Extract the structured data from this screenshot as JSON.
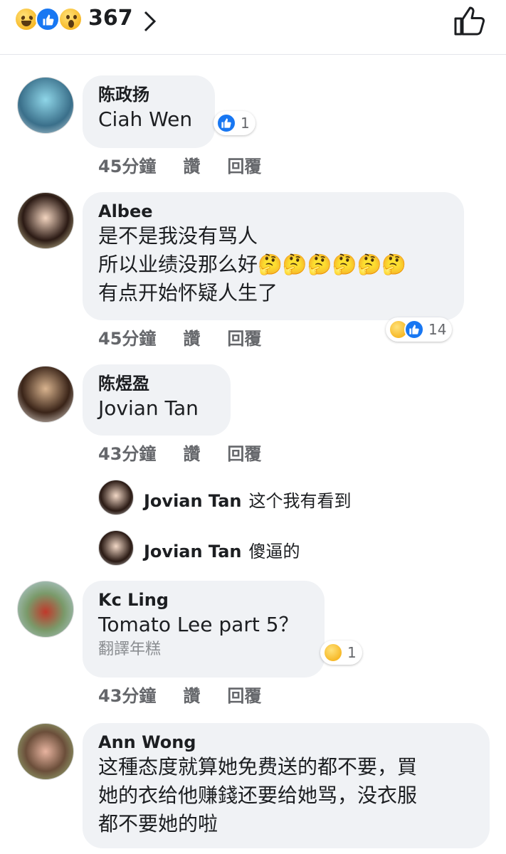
{
  "header": {
    "reaction_count": "367",
    "reactions": [
      "laugh-icon",
      "like-icon",
      "wow-icon"
    ],
    "like_button_icon": "like-outline-icon"
  },
  "actions": {
    "like": "讚",
    "reply": "回覆"
  },
  "comments": [
    {
      "name": "陈政扬",
      "text": "Ciah Wen",
      "time": "45分鐘",
      "reaction_icons": [
        "like-icon"
      ],
      "reaction_count": "1"
    },
    {
      "name": "Albee",
      "text": "是不是我没有骂人\n所以业绩没那么好🤔🤔🤔🤔🤔🤔\n有点开始怀疑人生了",
      "time": "45分鐘",
      "reaction_icons": [
        "laugh-icon",
        "like-icon"
      ],
      "reaction_count": "14"
    },
    {
      "name": "陈煜盈",
      "text": "Jovian Tan",
      "time": "43分鐘"
    },
    {
      "name": "Kc Ling",
      "text": "Tomato Lee part 5？",
      "translate": "翻譯年糕",
      "time": "43分鐘",
      "reaction_icons": [
        "wow-icon"
      ],
      "reaction_count": "1"
    },
    {
      "name": "Ann Wong",
      "text": "这種态度就算她免费送的都不要，買\n她的衣给他赚錢还要给她骂，没衣服\n都不要她的啦"
    }
  ],
  "replies": [
    {
      "name": "Jovian Tan",
      "text": "这个我有看到"
    },
    {
      "name": "Jovian Tan",
      "text": "傻逼的"
    }
  ],
  "colors": {
    "like_blue": "#1877f2",
    "bubble_gray": "#f0f2f5",
    "meta_gray": "#65676b"
  }
}
